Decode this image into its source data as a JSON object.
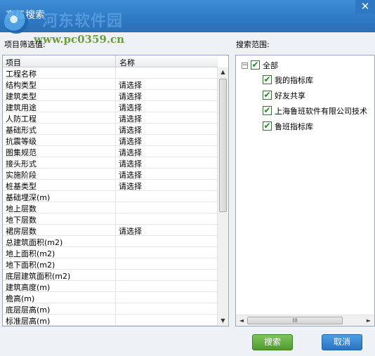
{
  "window": {
    "title": "高级搜索",
    "close_symbol": "✕"
  },
  "watermark": {
    "site": "河东软件园",
    "url": "www.pc0359.cn"
  },
  "left_panel": {
    "label": "项目筛选值:",
    "headers": [
      "项目",
      "名称"
    ],
    "rows": [
      [
        "工程名称",
        ""
      ],
      [
        "结构类型",
        "请选择"
      ],
      [
        "建筑类型",
        "请选择"
      ],
      [
        "建筑用途",
        "请选择"
      ],
      [
        "人防工程",
        "请选择"
      ],
      [
        "基础形式",
        "请选择"
      ],
      [
        "抗震等级",
        "请选择"
      ],
      [
        "图集规范",
        "请选择"
      ],
      [
        "接头形式",
        "请选择"
      ],
      [
        "实施阶段",
        "请选择"
      ],
      [
        "桩基类型",
        "请选择"
      ],
      [
        "基础埋深(m)",
        ""
      ],
      [
        "地上层数",
        ""
      ],
      [
        "地下层数",
        ""
      ],
      [
        "裙房层数",
        "请选择"
      ],
      [
        "总建筑面积(m2)",
        ""
      ],
      [
        "地上面积(m2)",
        ""
      ],
      [
        "地下面积(m2)",
        ""
      ],
      [
        "底层建筑面积(m2)",
        ""
      ],
      [
        "建筑高度(m)",
        ""
      ],
      [
        "檐高(m)",
        ""
      ],
      [
        "底层层高(m)",
        ""
      ],
      [
        "标准层高(m)",
        ""
      ]
    ]
  },
  "right_panel": {
    "label": "搜索范围:",
    "tree": {
      "root": {
        "label": "全部",
        "checked": true,
        "expander": "−"
      },
      "children": [
        {
          "label": "我的指标库",
          "checked": true
        },
        {
          "label": "好友共享",
          "checked": true
        },
        {
          "label": "上海鲁班软件有限公司技术",
          "checked": true
        },
        {
          "label": "鲁班指标库",
          "checked": true
        }
      ]
    },
    "scroll_grip": "III"
  },
  "buttons": {
    "search": "搜索",
    "cancel": "取消"
  },
  "colors": {
    "title_bar": "#2f79c4",
    "search_button": "#5ba838",
    "cancel_button": "#3486d3",
    "check": "#1f8a1f"
  }
}
